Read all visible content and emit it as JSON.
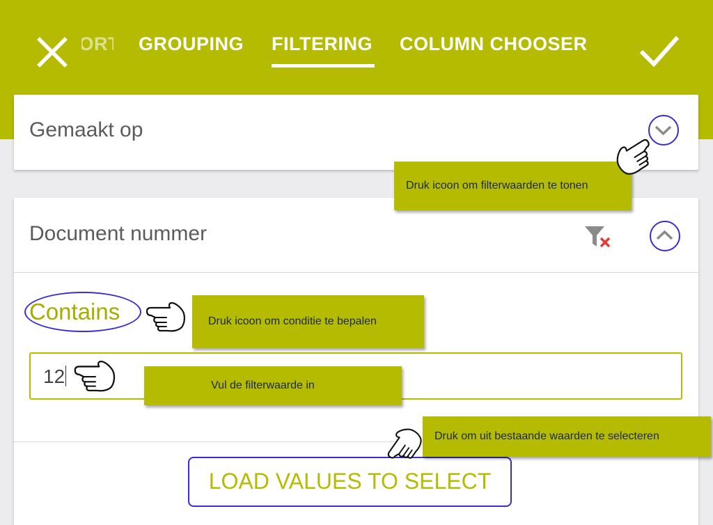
{
  "header": {
    "tabs": [
      {
        "label": "SORTING",
        "partial": true
      },
      {
        "label": "GROUPING"
      },
      {
        "label": "FILTERING",
        "active": true
      },
      {
        "label": "COLUMN CHOOSER"
      }
    ]
  },
  "fields": {
    "created_on": {
      "label": "Gemaakt op",
      "expanded": false
    },
    "document_number": {
      "label": "Document nummer",
      "expanded": true,
      "condition": "Contains",
      "value": "12",
      "load_values_label": "LOAD VALUES TO SELECT"
    }
  },
  "tooltips": {
    "expand": "Druk icoon om filterwaarden te tonen",
    "condition": "Druk icoon om conditie te bepalen",
    "value": "Vul de filterwaarde in",
    "select": "Druk om uit bestaande waarden te selecteren"
  },
  "colors": {
    "accent": "#b4bb00",
    "highlight": "#3a2bd6",
    "clear_filter": "#e53935",
    "tooltip_text": "#1d2a45"
  },
  "icons": [
    "close-icon",
    "check-icon",
    "chevron-down-icon",
    "chevron-up-icon",
    "clear-filter-icon",
    "pointing-hand-icon"
  ]
}
